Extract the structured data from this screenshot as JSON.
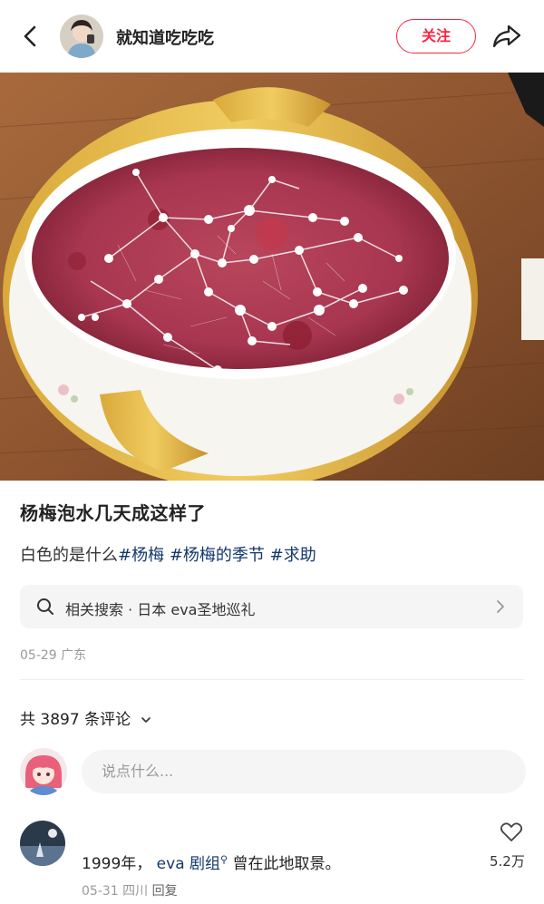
{
  "header": {
    "author_name": "就知道吃吃吃",
    "follow_label": "关注",
    "back_icon": "chevron-left-icon",
    "share_icon": "share-icon"
  },
  "post": {
    "title": "杨梅泡水几天成这样了",
    "desc_text": "白色的是什么",
    "tags": [
      "#杨梅",
      "#杨梅的季节",
      "#求助"
    ],
    "related_search": "相关搜索 · 日本 eva圣地巡礼",
    "meta": "05-29 广东"
  },
  "comments": {
    "count_label": "共 3897 条评论",
    "input_placeholder": "说点什么...",
    "items": [
      {
        "text_prefix": "1999年，",
        "link_text": "eva 剧组",
        "text_suffix": "曾在此地取景。",
        "meta": "05-31 四川",
        "reply_label": "回复",
        "likes": "5.2万"
      }
    ]
  },
  "colors": {
    "accent": "#ff2442",
    "tag": "#13386c",
    "muted": "#999999"
  }
}
